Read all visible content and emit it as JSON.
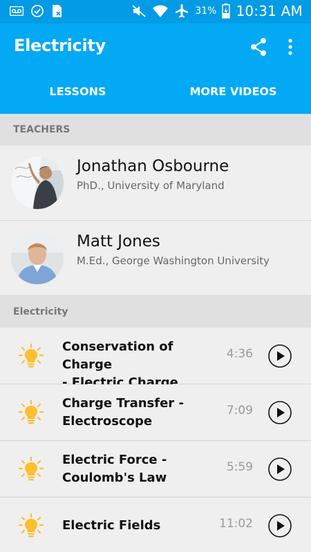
{
  "status_bar": {
    "battery_percent": "31%",
    "time": "10:31 AM",
    "icons": [
      "voicemail-icon",
      "check-circle-icon",
      "sim-off-icon",
      "mute-icon",
      "wifi-icon",
      "airplane-icon",
      "battery-charging-icon"
    ]
  },
  "app_bar": {
    "title": "Electricity",
    "share_icon": "share-icon",
    "more_icon": "more-vert-icon"
  },
  "tabs": [
    {
      "label": "LESSONS",
      "selected": true
    },
    {
      "label": "MORE VIDEOS",
      "selected": false
    }
  ],
  "teachers_section": {
    "header": "TEACHERS",
    "items": [
      {
        "name": "Jonathan Osbourne",
        "credential": "PhD., University of Maryland"
      },
      {
        "name": "Matt Jones",
        "credential": "M.Ed., George Washington University"
      }
    ]
  },
  "lessons_section": {
    "header": "Electricity",
    "items": [
      {
        "title_line1": "Conservation of Charge",
        "title_line2": "- Electric Charge",
        "duration": "4:36"
      },
      {
        "title_line1": "Charge Transfer -",
        "title_line2": "Electroscope",
        "duration": "7:09"
      },
      {
        "title_line1": "Electric Force -",
        "title_line2": "Coulomb's Law",
        "duration": "5:59"
      },
      {
        "title_line1": "Electric Fields",
        "title_line2": "",
        "duration": "11:02"
      }
    ]
  },
  "colors": {
    "status_bar": "#039be5",
    "app_bar": "#03a9f4",
    "bulb": "#fbc02d",
    "background": "#efefef",
    "section_header_bg": "#e0e0e0"
  }
}
